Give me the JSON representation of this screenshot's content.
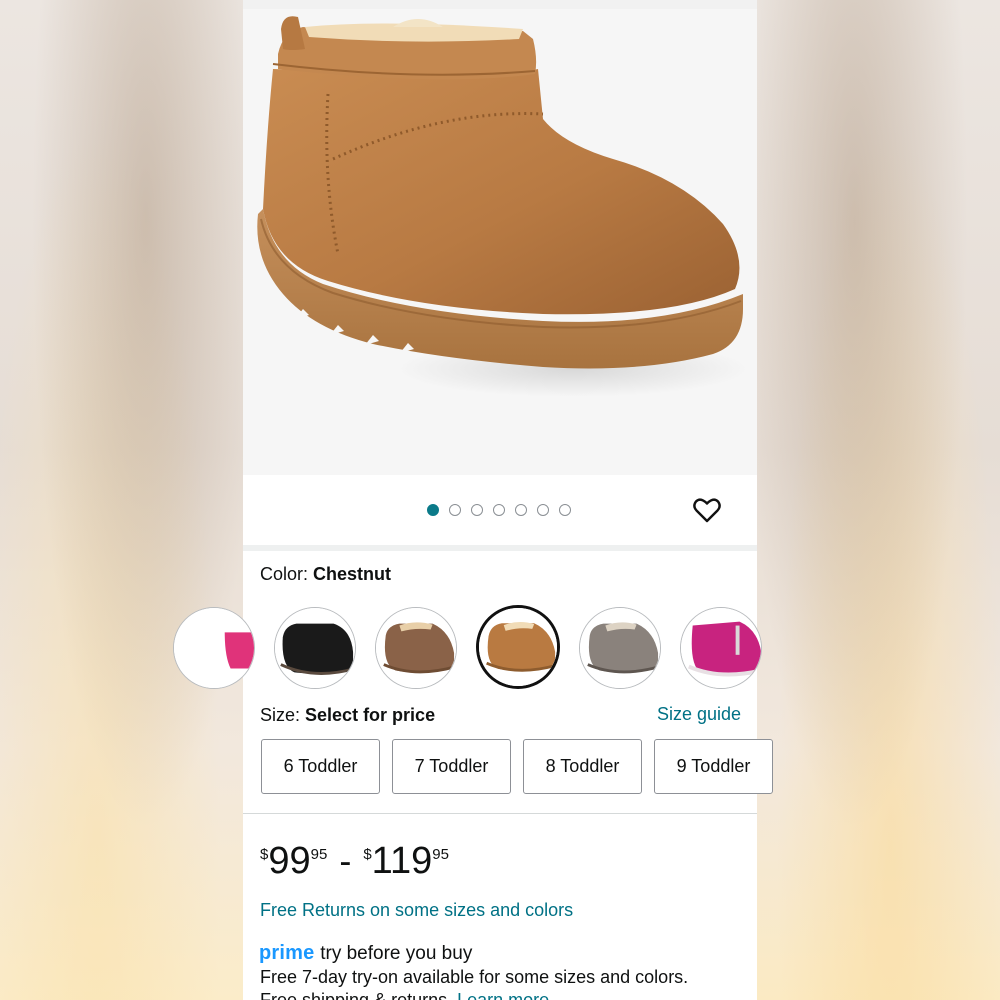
{
  "gallery": {
    "image_alt": "Chestnut suede mini boot",
    "dot_count": 7,
    "active_dot": 0,
    "favorite_icon": "heart-icon"
  },
  "color": {
    "label": "Color:",
    "selected": "Chestnut",
    "swatches": [
      {
        "name": "pink-partial",
        "color": "#e0337a"
      },
      {
        "name": "black",
        "color": "#1a1a1a"
      },
      {
        "name": "brown",
        "color": "#8a6248"
      },
      {
        "name": "chestnut",
        "color": "#b97a41",
        "selected": true
      },
      {
        "name": "grey",
        "color": "#8a827c"
      },
      {
        "name": "magenta",
        "color": "#c8237f"
      }
    ]
  },
  "size": {
    "label": "Size:",
    "value": "Select for price",
    "guide_link": "Size guide",
    "options": [
      "6 Toddler",
      "7 Toddler",
      "8 Toddler",
      "9 Toddler"
    ]
  },
  "price": {
    "currency": "$",
    "low_dollars": "99",
    "low_cents": "95",
    "separator": "-",
    "high_dollars": "119",
    "high_cents": "95"
  },
  "returns": {
    "link": "Free Returns on some sizes and colors"
  },
  "prime": {
    "brand": "prime",
    "tagline": "try before you buy",
    "description": "Free 7-day try-on available for some sizes and colors.",
    "shipping_text": "Free shipping & returns.",
    "learn_more": "Learn more"
  },
  "colors": {
    "link": "#007185",
    "active_dot": "#0b7a89",
    "prime_blue": "#1a98ff",
    "text": "#0f1111"
  }
}
